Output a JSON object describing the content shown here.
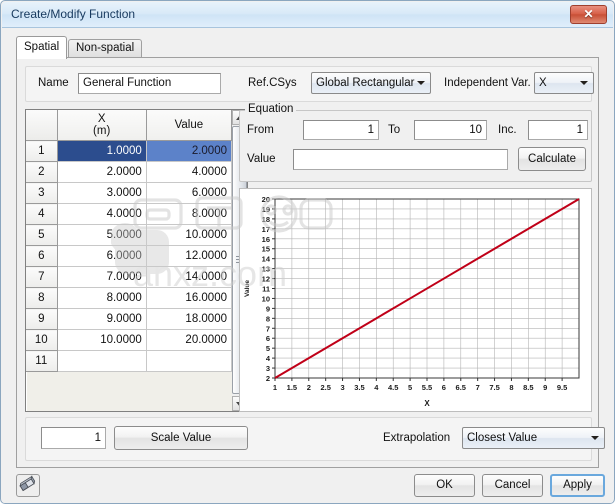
{
  "window": {
    "title": "Create/Modify Function",
    "close_label": "✕"
  },
  "tabs": [
    {
      "label": "Spatial",
      "active": true
    },
    {
      "label": "Non-spatial",
      "active": false
    }
  ],
  "topform": {
    "name_label": "Name",
    "name_value": "General Function",
    "refcsys_label": "Ref.CSys",
    "refcsys_value": "Global Rectangular",
    "indepvar_label": "Independent Var.",
    "indepvar_value": "X"
  },
  "table": {
    "headers": [
      "",
      "X\n(m)",
      "Value"
    ],
    "header_x_line1": "X",
    "header_x_line2": "(m)",
    "header_value": "Value",
    "selected_row": 1,
    "rows": [
      {
        "n": "1",
        "x": "1.0000",
        "v": "2.0000"
      },
      {
        "n": "2",
        "x": "2.0000",
        "v": "4.0000"
      },
      {
        "n": "3",
        "x": "3.0000",
        "v": "6.0000"
      },
      {
        "n": "4",
        "x": "4.0000",
        "v": "8.0000"
      },
      {
        "n": "5",
        "x": "5.0000",
        "v": "10.0000"
      },
      {
        "n": "6",
        "x": "6.0000",
        "v": "12.0000"
      },
      {
        "n": "7",
        "x": "7.0000",
        "v": "14.0000"
      },
      {
        "n": "8",
        "x": "8.0000",
        "v": "16.0000"
      },
      {
        "n": "9",
        "x": "9.0000",
        "v": "18.0000"
      },
      {
        "n": "10",
        "x": "10.0000",
        "v": "20.0000"
      },
      {
        "n": "11",
        "x": "",
        "v": ""
      }
    ]
  },
  "equation": {
    "legend": "Equation",
    "from_label": "From",
    "from_value": "1",
    "to_label": "To",
    "to_value": "10",
    "inc_label": "Inc.",
    "inc_value": "1",
    "value_label": "Value",
    "value_value": "",
    "calculate_label": "Calculate"
  },
  "scale": {
    "value": "1",
    "button_label": "Scale Value",
    "extrapolation_label": "Extrapolation",
    "extrapolation_value": "Closest Value"
  },
  "footer": {
    "eraser_icon": "eraser-icon",
    "ok_label": "OK",
    "cancel_label": "Cancel",
    "apply_label": "Apply"
  },
  "colors": {
    "line": "#c00018",
    "selection_primary": "#2c4d8e",
    "selection_secondary": "#5c82c9",
    "titlebar": "#d9eaf8",
    "close_button": "#c84f36",
    "focus_ring": "#6aa8dd"
  },
  "watermark": {
    "text": "anxz.com"
  },
  "chart_data": {
    "type": "line",
    "title": "",
    "xlabel": "X",
    "ylabel": "Value",
    "xlim": [
      1,
      10
    ],
    "ylim": [
      2,
      20
    ],
    "grid": true,
    "legend": "none",
    "xticks": [
      "1",
      "1.5",
      "2",
      "2.5",
      "3",
      "3.5",
      "4",
      "4.5",
      "5",
      "5.5",
      "6",
      "6.5",
      "7",
      "7.5",
      "8",
      "8.5",
      "9",
      "9.5"
    ],
    "xtick_values": [
      1,
      1.5,
      2,
      2.5,
      3,
      3.5,
      4,
      4.5,
      5,
      5.5,
      6,
      6.5,
      7,
      7.5,
      8,
      8.5,
      9,
      9.5
    ],
    "yticks": [
      "2",
      "3",
      "4",
      "5",
      "6",
      "7",
      "8",
      "9",
      "10",
      "11",
      "12",
      "13",
      "14",
      "15",
      "16",
      "17",
      "18",
      "19",
      "20"
    ],
    "ytick_values": [
      2,
      3,
      4,
      5,
      6,
      7,
      8,
      9,
      10,
      11,
      12,
      13,
      14,
      15,
      16,
      17,
      18,
      19,
      20
    ],
    "series": [
      {
        "name": "Value",
        "color": "#c00018",
        "x": [
          1,
          2,
          3,
          4,
          5,
          6,
          7,
          8,
          9,
          10
        ],
        "values": [
          2,
          4,
          6,
          8,
          10,
          12,
          14,
          16,
          18,
          20
        ]
      }
    ]
  }
}
